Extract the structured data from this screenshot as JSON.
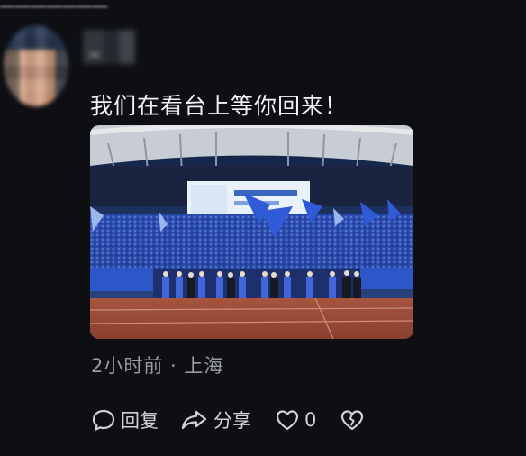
{
  "post": {
    "comment_text": "我们在看台上等你回来！",
    "time_location": "2小时前 · 上海"
  },
  "actions": {
    "reply_label": "回复",
    "share_label": "分享",
    "like_count": "0"
  },
  "icons": {
    "reply": "speech-bubble-icon",
    "share": "share-arrow-icon",
    "like": "heart-icon",
    "dislike": "broken-heart-icon"
  },
  "colors": {
    "background": "#0d0f13",
    "comment_text": "#f2f2f4",
    "meta_text": "#9a9ca3",
    "action_text": "#d0d2d7"
  }
}
